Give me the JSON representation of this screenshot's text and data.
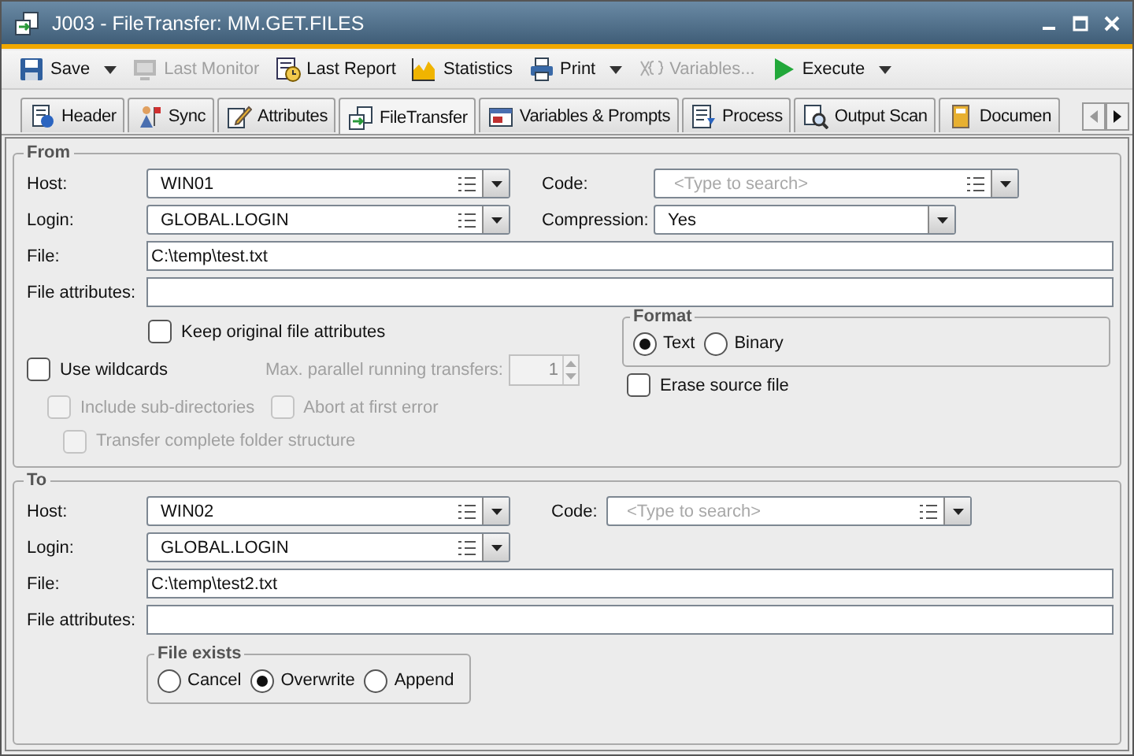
{
  "window": {
    "title": "J003 - FileTransfer: MM.GET.FILES"
  },
  "toolbar": [
    {
      "label": "Save",
      "disabled": false,
      "dropdown": true
    },
    {
      "label": "Last Monitor",
      "disabled": true,
      "dropdown": false
    },
    {
      "label": "Last Report",
      "disabled": false,
      "dropdown": false
    },
    {
      "label": "Statistics",
      "disabled": false,
      "dropdown": false
    },
    {
      "label": "Print",
      "disabled": false,
      "dropdown": true
    },
    {
      "label": "Variables...",
      "disabled": true,
      "dropdown": false
    },
    {
      "label": "Execute",
      "disabled": false,
      "dropdown": true
    }
  ],
  "tabs": [
    {
      "label": "Header",
      "selected": false
    },
    {
      "label": "Sync",
      "selected": false
    },
    {
      "label": "Attributes",
      "selected": false
    },
    {
      "label": "FileTransfer",
      "selected": true
    },
    {
      "label": "Variables & Prompts",
      "selected": false
    },
    {
      "label": "Process",
      "selected": false
    },
    {
      "label": "Output Scan",
      "selected": false
    },
    {
      "label": "Documen",
      "selected": false
    }
  ],
  "from": {
    "legend": "From",
    "host": {
      "label": "Host:",
      "value": "WIN01"
    },
    "code": {
      "label": "Code:",
      "placeholder": "<Type to search>"
    },
    "login": {
      "label": "Login:",
      "value": "GLOBAL.LOGIN"
    },
    "compression": {
      "label": "Compression:",
      "value": "Yes"
    },
    "file": {
      "label": "File:",
      "value": "C:\\temp\\test.txt"
    },
    "file_attributes": {
      "label": "File attributes:"
    },
    "keep_original": {
      "label": "Keep original file attributes",
      "checked": false,
      "disabled": false
    },
    "use_wildcards": {
      "label": "Use wildcards",
      "checked": false,
      "disabled": false
    },
    "max_parallel": {
      "label": "Max. parallel running transfers:",
      "value": "1",
      "disabled": true
    },
    "include_subdirectories": {
      "label": "Include sub-directories",
      "checked": false,
      "disabled": true
    },
    "abort_first_error": {
      "label": "Abort at first error",
      "checked": false,
      "disabled": true
    },
    "transfer_folder_structure": {
      "label": "Transfer complete folder structure",
      "checked": false,
      "disabled": true
    },
    "format": {
      "legend": "Format",
      "options": [
        {
          "label": "Text",
          "selected": true
        },
        {
          "label": "Binary",
          "selected": false
        }
      ]
    },
    "erase_source": {
      "label": "Erase source file",
      "checked": false,
      "disabled": false
    }
  },
  "to": {
    "legend": "To",
    "host": {
      "label": "Host:",
      "value": "WIN02"
    },
    "code": {
      "label": "Code:",
      "placeholder": "<Type to search>"
    },
    "login": {
      "label": "Login:",
      "value": "GLOBAL.LOGIN"
    },
    "file": {
      "label": "File:",
      "value": "C:\\temp\\test2.txt"
    },
    "file_attributes": {
      "label": "File attributes:"
    },
    "file_exists": {
      "legend": "File exists",
      "options": [
        {
          "label": "Cancel",
          "selected": false
        },
        {
          "label": "Overwrite",
          "selected": true
        },
        {
          "label": "Append",
          "selected": false
        }
      ]
    }
  }
}
